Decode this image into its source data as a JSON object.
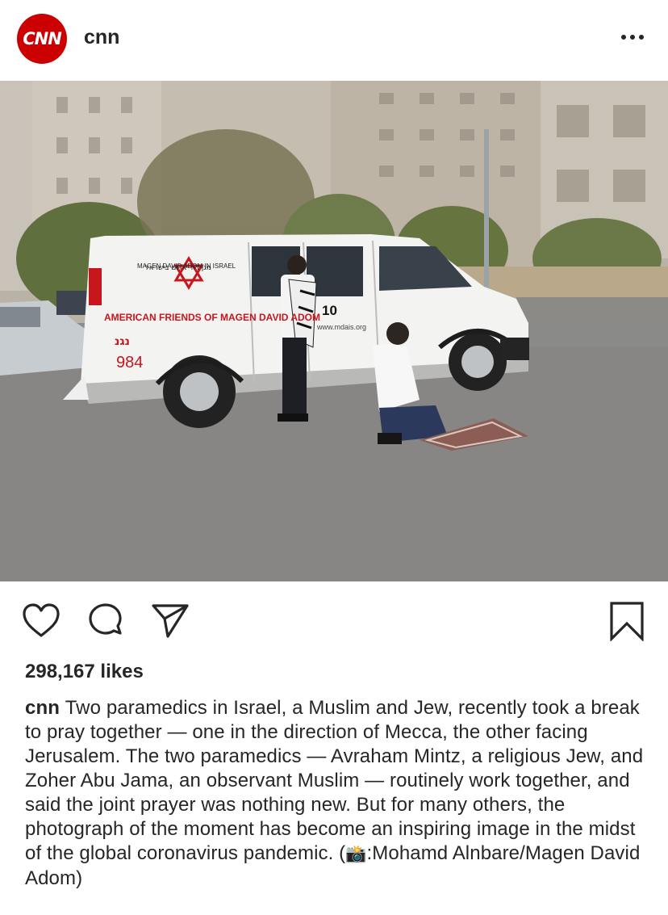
{
  "post": {
    "username": "cnn",
    "avatar_text": "CNN",
    "more_icon": "more-horizontal-icon",
    "likes": "298,167 likes",
    "caption_text": "Two paramedics in Israel, a Muslim and Jew, recently took a break to pray together — one in the direction of Mecca, the other facing Jerusalem. The two paramedics — Avraham Mintz, a religious Jew, and Zoher Abu Jama, an observant Muslim — routinely work together, and said the joint prayer was nothing new. But for many others, the photograph of the moment has become an inspiring image in the midst of the global coronavirus pandemic. (",
    "caption_emoji": "📸",
    "caption_credit": ":Mohamd Alnbare/Magen David Adom)"
  },
  "photo": {
    "van_org_en": "MAGEN DAVID ADOM IN ISRAEL",
    "van_org_he": "מגן דוד אדום בישראל",
    "van_friends": "AMERICAN FRIENDS OF MAGEN DAVID ADOM",
    "van_he_short": "נגנ",
    "van_number": "984",
    "van_site": "www.mdais.org",
    "van_unit": "10"
  },
  "actions": {
    "like_icon": "heart-icon",
    "comment_icon": "comment-icon",
    "share_icon": "send-icon",
    "save_icon": "bookmark-icon"
  },
  "colors": {
    "brand_red": "#cc0000",
    "text": "#262626",
    "background": "#ffffff"
  }
}
